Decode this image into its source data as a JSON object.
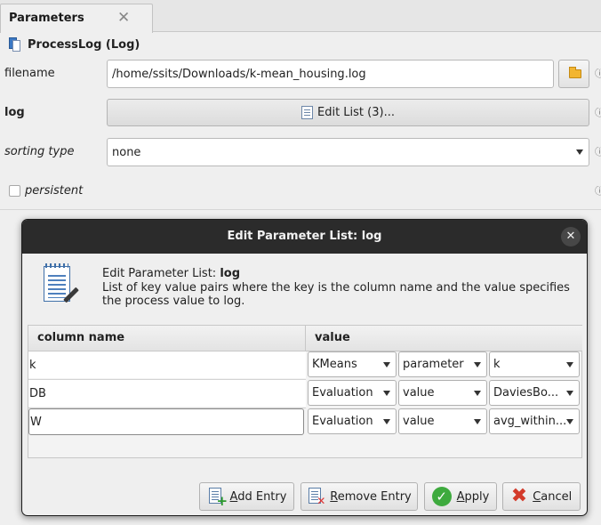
{
  "tab": {
    "title": "Parameters",
    "close_glyph": "✕"
  },
  "process": {
    "title": "ProcessLog (Log)"
  },
  "params": {
    "filename": {
      "label": "filename",
      "value": "/home/ssits/Downloads/k-mean_housing.log"
    },
    "log": {
      "label": "log",
      "button": "Edit List (3)..."
    },
    "sorting": {
      "label": "sorting type",
      "value": "none"
    },
    "persistent": {
      "label": "persistent",
      "checked": false
    }
  },
  "info_glyph": "ⓘ",
  "dialog": {
    "title": "Edit Parameter List: log",
    "close_glyph": "✕",
    "heading_prefix": "Edit Parameter List: ",
    "heading_bold": "log",
    "description": "List of key value pairs where the key is the column name and the value specifies the process value to log.",
    "columns": [
      "column name",
      "value"
    ],
    "rows": [
      {
        "key": "k",
        "v1": "KMeans",
        "v2": "parameter",
        "v3": "k"
      },
      {
        "key": "DB",
        "v1": "Evaluation",
        "v2": "value",
        "v3": "DaviesBo..."
      },
      {
        "key": "W",
        "v1": "Evaluation",
        "v2": "value",
        "v3": "avg_within..."
      }
    ],
    "buttons": {
      "add_u": "A",
      "add_rest": "dd Entry",
      "remove_u": "R",
      "remove_rest": "emove Entry",
      "apply_u": "A",
      "apply_rest": "pply",
      "cancel_u": "C",
      "cancel_rest": "ancel"
    }
  }
}
